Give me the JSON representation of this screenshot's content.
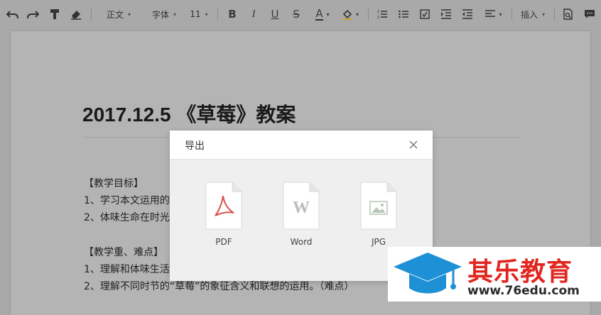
{
  "toolbar": {
    "undo_icon": "undo-icon",
    "redo_icon": "redo-icon",
    "style_dropdown": "正文",
    "font_dropdown": "字体",
    "size_dropdown": "11",
    "bold": "B",
    "italic": "I",
    "underline": "U",
    "strike": "S",
    "font_color": "A",
    "insert_dropdown": "插入"
  },
  "document": {
    "title": "2017.12.5 《草莓》教案",
    "lines": [
      "【教学目标】",
      "1、学习本文运用的",
      "2、体味生命在时光",
      "【教学重、难点】",
      "1、理解和体味生活",
      "2、理解不同时节的“草莓”的象征含义和联想的运用。（难点）"
    ]
  },
  "dialog": {
    "title": "导出",
    "options": [
      {
        "label": "PDF",
        "icon": "pdf-file-icon"
      },
      {
        "label": "Word",
        "icon": "word-file-icon"
      },
      {
        "label": "JPG",
        "icon": "jpg-file-icon"
      }
    ],
    "word_glyph": "W"
  },
  "watermark": {
    "name": "其乐教育",
    "url": "www.76edu.com"
  },
  "colors": {
    "overlay_bg": "#a9a9a9",
    "page_bg": "#b4b4b4",
    "dialog_bg": "#efefef",
    "pdf_red": "#d9534f",
    "logo_red": "#e2261f",
    "logo_blue": "#1e90d6"
  }
}
